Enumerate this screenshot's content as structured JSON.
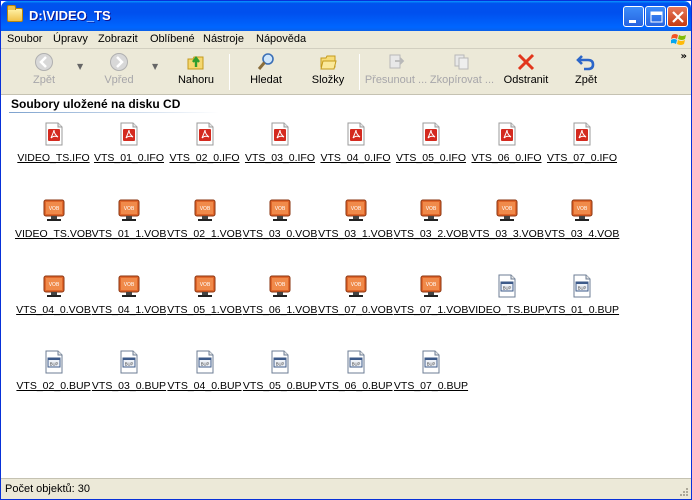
{
  "window": {
    "title": "D:\\VIDEO_TS"
  },
  "menu": [
    "Soubor",
    "Úpravy",
    "Zobrazit",
    "Oblíbené",
    "Nástroje",
    "Nápověda"
  ],
  "toolbar": {
    "back": "Zpět",
    "forward": "Vpřed",
    "up": "Nahoru",
    "search": "Hledat",
    "folders": "Složky",
    "move": "Přesunout ...",
    "copy": "Zkopírovat ...",
    "delete": "Odstranit",
    "undo": "Zpět"
  },
  "content": {
    "section_title": "Soubory uložené na disku CD"
  },
  "files": [
    {
      "name": "VIDEO_TS.IFO",
      "type": "pdf"
    },
    {
      "name": "VTS_01_0.IFO",
      "type": "pdf"
    },
    {
      "name": "VTS_02_0.IFO",
      "type": "pdf"
    },
    {
      "name": "VTS_03_0.IFO",
      "type": "pdf"
    },
    {
      "name": "VTS_04_0.IFO",
      "type": "pdf"
    },
    {
      "name": "VTS_05_0.IFO",
      "type": "pdf"
    },
    {
      "name": "VTS_06_0.IFO",
      "type": "pdf"
    },
    {
      "name": "VTS_07_0.IFO",
      "type": "pdf"
    },
    {
      "name": "VIDEO_TS.VOB",
      "type": "vob"
    },
    {
      "name": "VTS_01_1.VOB",
      "type": "vob"
    },
    {
      "name": "VTS_02_1.VOB",
      "type": "vob"
    },
    {
      "name": "VTS_03_0.VOB",
      "type": "vob"
    },
    {
      "name": "VTS_03_1.VOB",
      "type": "vob"
    },
    {
      "name": "VTS_03_2.VOB",
      "type": "vob"
    },
    {
      "name": "VTS_03_3.VOB",
      "type": "vob"
    },
    {
      "name": "VTS_03_4.VOB",
      "type": "vob"
    },
    {
      "name": "VTS_04_0.VOB",
      "type": "vob"
    },
    {
      "name": "VTS_04_1.VOB",
      "type": "vob"
    },
    {
      "name": "VTS_05_1.VOB",
      "type": "vob"
    },
    {
      "name": "VTS_06_1.VOB",
      "type": "vob"
    },
    {
      "name": "VTS_07_0.VOB",
      "type": "vob"
    },
    {
      "name": "VTS_07_1.VOB",
      "type": "vob"
    },
    {
      "name": "VIDEO_TS.BUP",
      "type": "bup"
    },
    {
      "name": "VTS_01_0.BUP",
      "type": "bup"
    },
    {
      "name": "VTS_02_0.BUP",
      "type": "bup"
    },
    {
      "name": "VTS_03_0.BUP",
      "type": "bup"
    },
    {
      "name": "VTS_04_0.BUP",
      "type": "bup"
    },
    {
      "name": "VTS_05_0.BUP",
      "type": "bup"
    },
    {
      "name": "VTS_06_0.BUP",
      "type": "bup"
    },
    {
      "name": "VTS_07_0.BUP",
      "type": "bup"
    }
  ],
  "status": {
    "text": "Počet objektů: 30"
  },
  "icons": {
    "pdf": "pdf-file-icon",
    "vob": "vob-media-icon",
    "bup": "bup-file-icon"
  },
  "colors": {
    "titlebar": "#0054e3",
    "chrome": "#ece9d8",
    "pdf_red": "#d42a1f",
    "vob_orange": "#e0662a"
  }
}
